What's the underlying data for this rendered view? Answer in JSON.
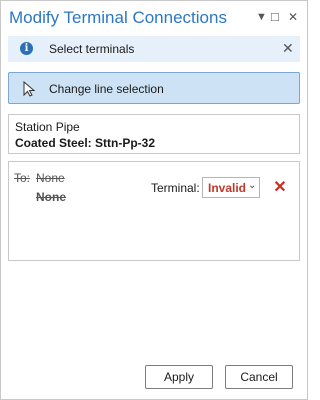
{
  "window": {
    "title": "Modify Terminal Connections",
    "controls": {
      "menu": "▼",
      "maximize": "□",
      "close": "✕"
    }
  },
  "message": {
    "icon": "info-icon",
    "text": "Select terminals",
    "close": "✕"
  },
  "line_selection": {
    "label": "Change line selection",
    "icon": "cursor-icon"
  },
  "feature": {
    "class_name": "Station Pipe",
    "asset_name": "Coated Steel: Sttn-Pp-32"
  },
  "connection": {
    "to_label": "To:",
    "to_value": "None",
    "to_value_secondary": "None",
    "terminal_label": "Terminal:",
    "terminal_value": "Invalid",
    "terminal_value_color": "#c0392b",
    "remove_icon": "✕"
  },
  "buttons": {
    "apply": "Apply",
    "cancel": "Cancel"
  }
}
